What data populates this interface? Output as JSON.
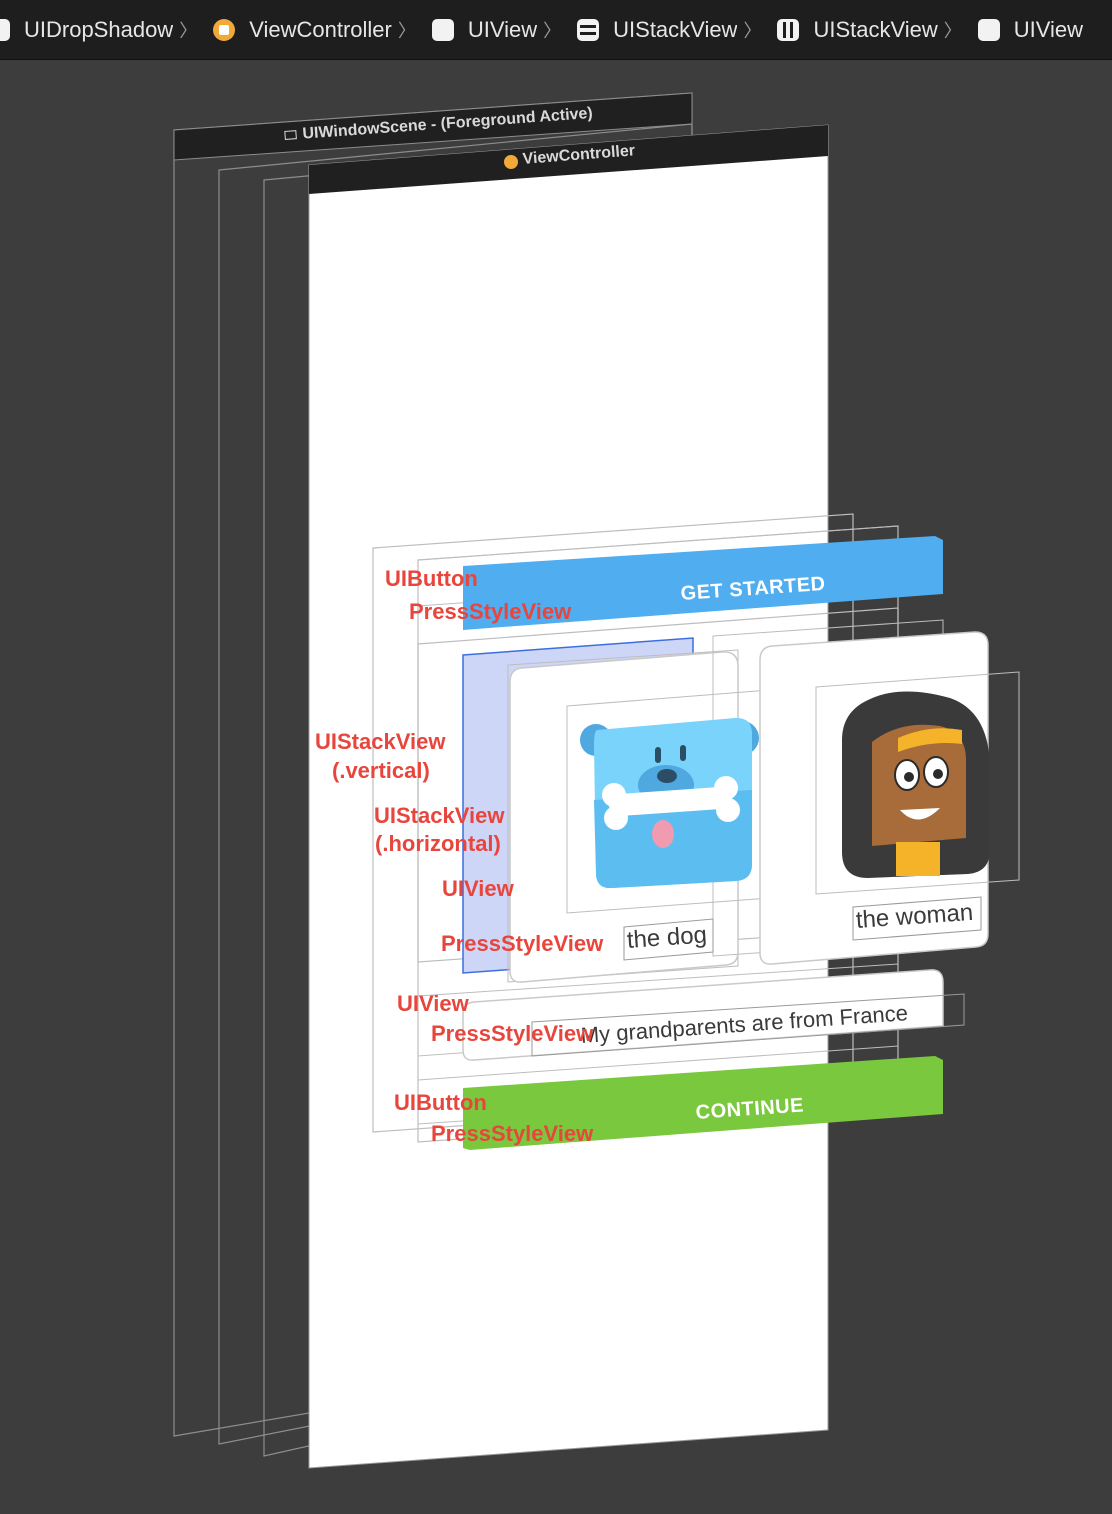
{
  "breadcrumbs": [
    {
      "label": "UIDropShadow",
      "icon": "view-icon"
    },
    {
      "label": "ViewController",
      "icon": "view-controller-icon"
    },
    {
      "label": "UIView",
      "icon": "view-icon"
    },
    {
      "label": "UIStackView",
      "icon": "vertical-stack-icon"
    },
    {
      "label": "UIStackView",
      "icon": "horizontal-stack-icon"
    },
    {
      "label": "UIView",
      "icon": "view-icon"
    }
  ],
  "scene": {
    "window_scene_title": "UIWindowScene - (Foreground Active)",
    "view_controller_title": "ViewController"
  },
  "app": {
    "get_started_label": "GET STARTED",
    "continue_label": "CONTINUE",
    "card_dog_label": "the dog",
    "card_woman_label": "the woman",
    "sentence": "My grandparents are from France"
  },
  "annotations": {
    "uibutton_top": "UIButton",
    "pressstyle_top": "PressStyleView",
    "stack_vertical": "UIStackView",
    "stack_vertical_sub": "(.vertical)",
    "stack_horizontal": "UIStackView",
    "stack_horizontal_sub": "(.horizontal)",
    "uiview_card": "UIView",
    "pressstyle_card": "PressStyleView",
    "uiview_sentence": "UIView",
    "pressstyle_sentence": "PressStyleView",
    "uibutton_bottom": "UIButton",
    "pressstyle_bottom": "PressStyleView"
  },
  "colors": {
    "get_started": "#4fadf0",
    "continue": "#7ac83d",
    "annotation": "#e8453c",
    "selection": "#3b6fe0",
    "background": "#3d3d3d"
  }
}
